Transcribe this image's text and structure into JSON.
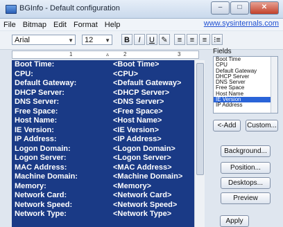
{
  "window": {
    "title": "BGInfo - Default configuration",
    "controls": {
      "minimize": "–",
      "maximize": "□",
      "close": "✕"
    }
  },
  "menu": {
    "items": [
      "File",
      "Bitmap",
      "Edit",
      "Format",
      "Help"
    ],
    "site_link": "www.sysinternals.com"
  },
  "toolbar": {
    "font": "Arial",
    "size": "12",
    "bold": "B",
    "italic": "I",
    "underline": "U",
    "align_left": "≡",
    "align_center": "≡",
    "align_right": "≡",
    "bullets": "⁝≡"
  },
  "ruler": {
    "marks": [
      "1",
      "2",
      "3"
    ]
  },
  "editor": {
    "rows": [
      {
        "label": "Boot Time:",
        "value": "<Boot Time>"
      },
      {
        "label": "CPU:",
        "value": "<CPU>"
      },
      {
        "label": "Default Gateway:",
        "value": "<Default Gateway>"
      },
      {
        "label": "DHCP Server:",
        "value": "<DHCP Server>"
      },
      {
        "label": "DNS Server:",
        "value": "<DNS Server>"
      },
      {
        "label": "Free Space:",
        "value": "<Free Space>"
      },
      {
        "label": "Host Name:",
        "value": "<Host Name>"
      },
      {
        "label": "IE Version:",
        "value": "<IE Version>"
      },
      {
        "label": "IP Address:",
        "value": "<IP Address>"
      },
      {
        "label": "Logon Domain:",
        "value": "<Logon Domain>"
      },
      {
        "label": "Logon Server:",
        "value": "<Logon Server>"
      },
      {
        "label": "MAC Address:",
        "value": "<MAC Address>"
      },
      {
        "label": "Machine Domain:",
        "value": "<Machine Domain>"
      },
      {
        "label": "Memory:",
        "value": "<Memory>"
      },
      {
        "label": "Network Card:",
        "value": "<Network Card>"
      },
      {
        "label": "Network Speed:",
        "value": "<Network Speed>"
      },
      {
        "label": "Network Type:",
        "value": "<Network Type>"
      }
    ]
  },
  "fields": {
    "label": "Fields",
    "items": [
      "Boot Time",
      "CPU",
      "Default Gateway",
      "DHCP Server",
      "DNS Server",
      "Free Space",
      "Host Name",
      "IE Version",
      "IP Address"
    ],
    "selected": "IE Version"
  },
  "buttons": {
    "add": "<-Add",
    "custom": "Custom...",
    "background": "Background...",
    "position": "Position...",
    "desktops": "Desktops...",
    "preview": "Preview",
    "apply": "Apply"
  }
}
